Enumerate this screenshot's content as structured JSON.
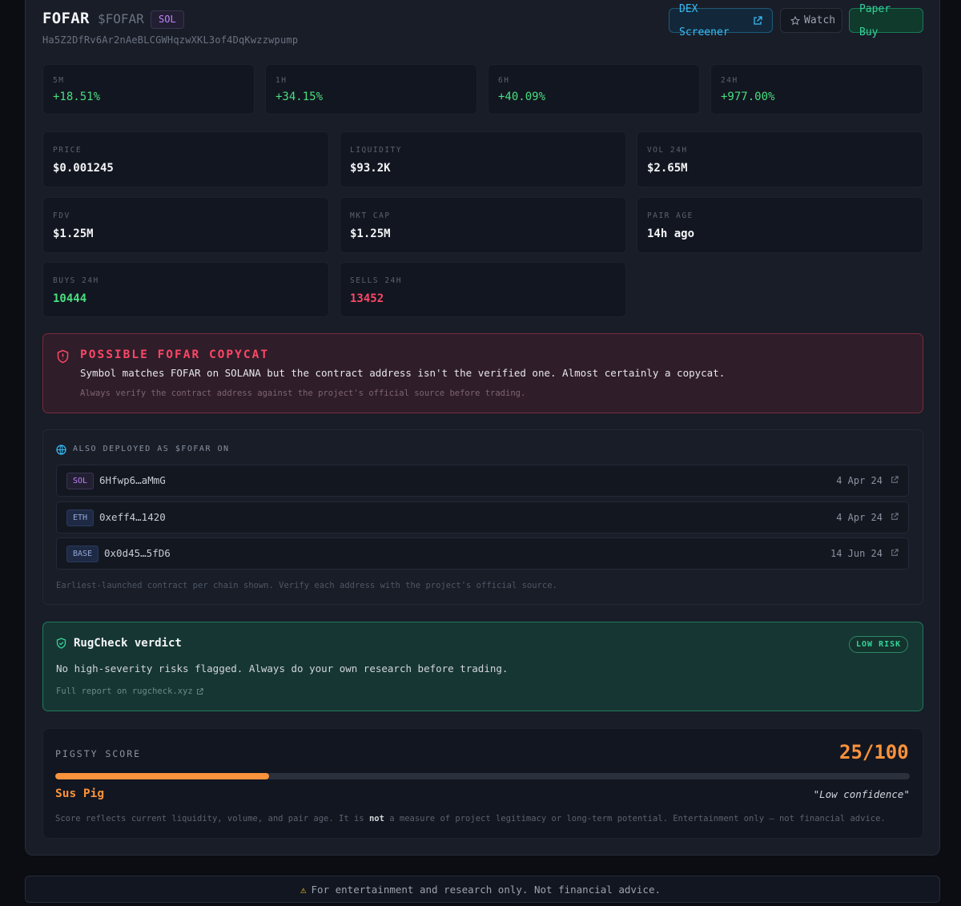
{
  "token": {
    "symbol": "FOFAR",
    "ticker": "$FOFAR",
    "chain": "SOL",
    "address": "Ha5Z2DfRv6Ar2nAeBLCGWHqzwXKL3of4DqKwzzwpump"
  },
  "actions": {
    "dex": "DEX Screener",
    "watch": "Watch",
    "paper_buy": "Paper Buy"
  },
  "changes": [
    {
      "label": "5M",
      "value": "+18.51%"
    },
    {
      "label": "1H",
      "value": "+34.15%"
    },
    {
      "label": "6H",
      "value": "+40.09%"
    },
    {
      "label": "24H",
      "value": "+977.00%"
    }
  ],
  "stats": [
    {
      "label": "PRICE",
      "value": "$0.001245"
    },
    {
      "label": "LIQUIDITY",
      "value": "$93.2K"
    },
    {
      "label": "VOL 24H",
      "value": "$2.65M"
    },
    {
      "label": "FDV",
      "value": "$1.25M"
    },
    {
      "label": "MKT CAP",
      "value": "$1.25M"
    },
    {
      "label": "PAIR AGE",
      "value": "14h ago"
    },
    {
      "label": "BUYS 24H",
      "value": "10444"
    },
    {
      "label": "SELLS 24H",
      "value": "13452"
    }
  ],
  "warning": {
    "title": "POSSIBLE FOFAR COPYCAT",
    "text": "Symbol matches FOFAR on SOLANA but the contract address isn't the verified one. Almost certainly a copycat.",
    "note": "Always verify the contract address against the project's official source before trading."
  },
  "deployed": {
    "title": "ALSO DEPLOYED AS $FOFAR ON",
    "rows": [
      {
        "chain": "SOL",
        "address": "6Hfwp6…aMmG",
        "date": "4 Apr 24"
      },
      {
        "chain": "ETH",
        "address": "0xeff4…1420",
        "date": "4 Apr 24"
      },
      {
        "chain": "BASE",
        "address": "0x0d45…5fD6",
        "date": "14 Jun 24"
      }
    ],
    "note": "Earliest-launched contract per chain shown. Verify each address with the project's official source."
  },
  "rugcheck": {
    "title": "RugCheck verdict",
    "badge": "LOW RISK",
    "text": "No high-severity risks flagged. Always do your own research before trading.",
    "link": "Full report on rugcheck.xyz"
  },
  "score": {
    "label": "PIGSTY SCORE",
    "value": "25/100",
    "fraction": 0.25,
    "tier": "Sus Pig",
    "confidence": "\"Low confidence\"",
    "note_pre": "Score reflects current liquidity, volume, and pair age. It is ",
    "note_bold": "not",
    "note_post": " a measure of project legitimacy or long-term potential. Entertainment only — not financial advice."
  },
  "footer": "For entertainment and research only. Not financial advice.",
  "colors": {
    "positive": "#4ade80",
    "negative": "#fb4766",
    "score_accent": "#fb923c"
  }
}
